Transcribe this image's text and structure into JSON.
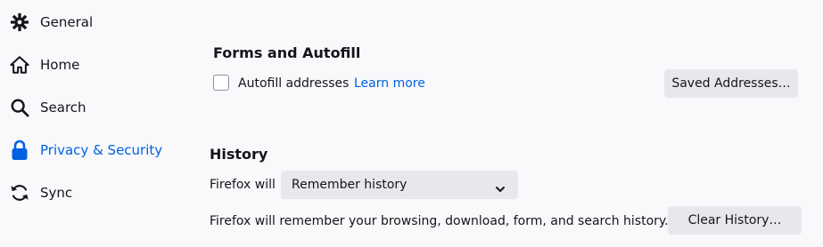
{
  "sidebar": {
    "items": [
      {
        "label": "General",
        "icon": "gear-icon"
      },
      {
        "label": "Home",
        "icon": "home-icon"
      },
      {
        "label": "Search",
        "icon": "search-icon"
      },
      {
        "label": "Privacy & Security",
        "icon": "lock-icon",
        "active": true
      },
      {
        "label": "Sync",
        "icon": "sync-icon"
      }
    ]
  },
  "forms_autofill": {
    "title": "Forms and Autofill",
    "autofill_addresses_label": "Autofill addresses",
    "autofill_addresses_checked": false,
    "learn_more": "Learn more",
    "saved_addresses_button": "Saved Addresses…"
  },
  "history": {
    "title": "History",
    "firefox_will_label": "Firefox will",
    "mode_selected": "Remember history",
    "description": "Firefox will remember your browsing, download, form, and search history.",
    "clear_history_button": "Clear History…"
  },
  "colors": {
    "accent": "#0061e0",
    "background": "#f9f9fb",
    "button_bg": "#e8e8ec",
    "text": "#15141a"
  }
}
